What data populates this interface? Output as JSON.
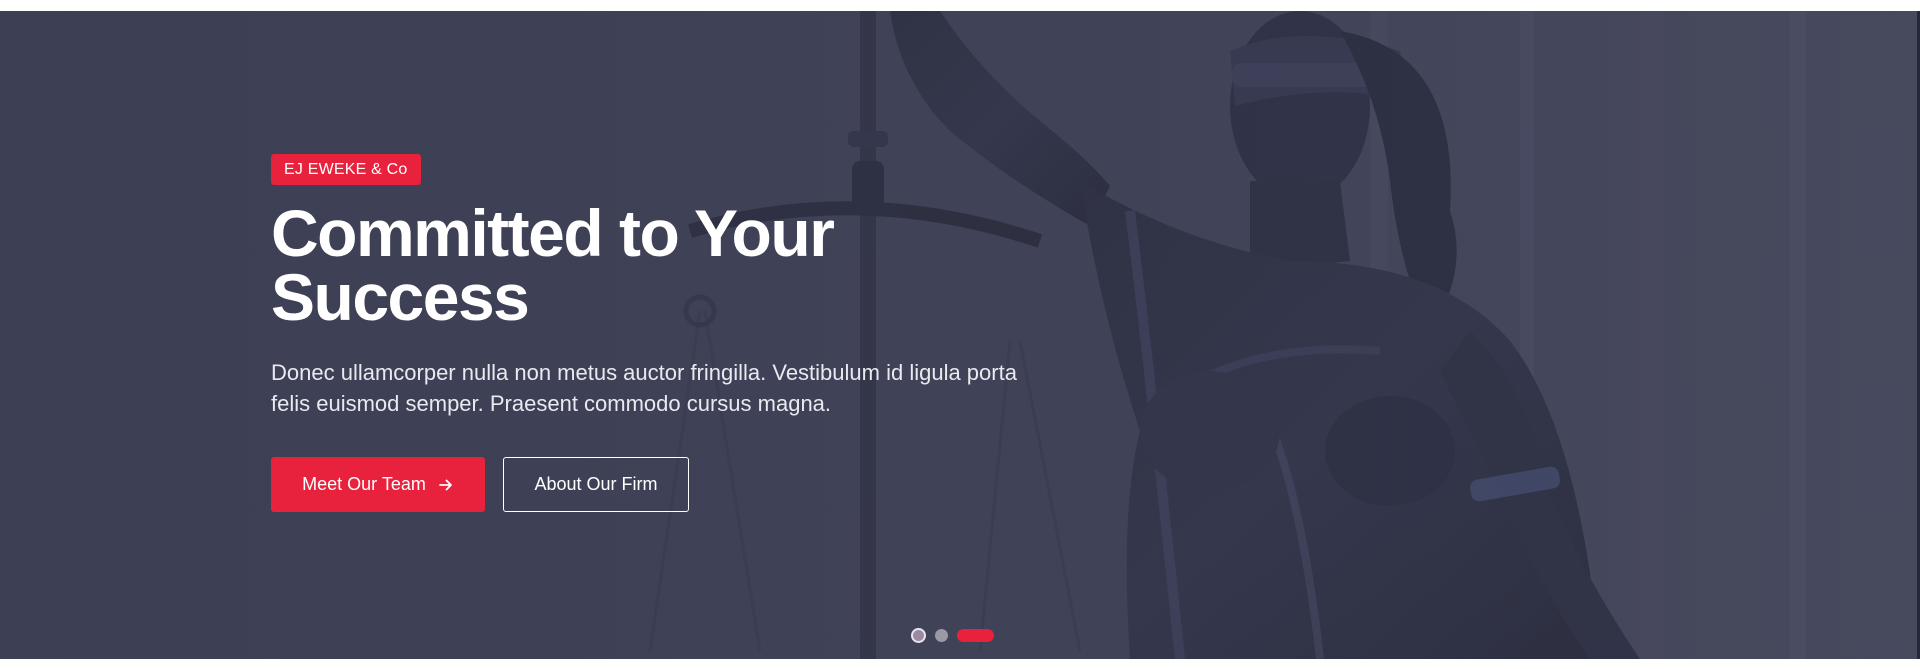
{
  "hero": {
    "badge": "EJ EWEKE & Co",
    "title": "Committed to Your Success",
    "lead": "Donec ullamcorper nulla non metus auctor fringilla. Vestibulum id ligula porta felis euismod semper. Praesent commodo cursus magna.",
    "background_image": "lady-justice-statue-with-scales",
    "primary_button": {
      "label": "Meet Our Team",
      "icon": "arrow-right-icon"
    },
    "secondary_button": {
      "label": "About Our Firm"
    }
  },
  "slider": {
    "total_slides": 3,
    "active_index": 2
  },
  "colors": {
    "accent": "#e8223c",
    "overlay": "#3b3d51",
    "text": "#ffffff"
  }
}
